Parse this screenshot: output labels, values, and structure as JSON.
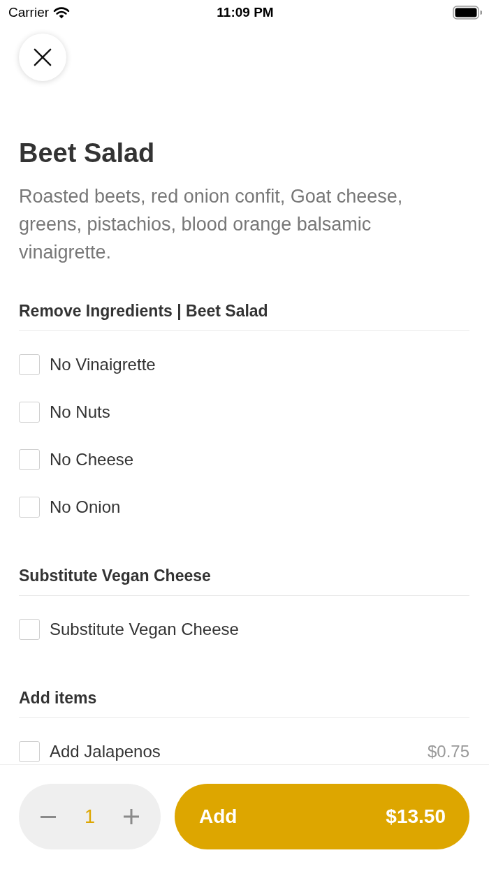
{
  "status_bar": {
    "carrier": "Carrier",
    "time": "11:09 PM"
  },
  "item": {
    "title": "Beet Salad",
    "description": "Roasted beets, red onion confit, Goat cheese, greens, pistachios, blood orange balsamic vinaigrette."
  },
  "sections": [
    {
      "title": "Remove Ingredients | Beet Salad",
      "options": [
        {
          "label": "No Vinaigrette",
          "checked": false
        },
        {
          "label": "No Nuts",
          "checked": false
        },
        {
          "label": "No Cheese",
          "checked": false
        },
        {
          "label": "No Onion",
          "checked": false
        }
      ]
    },
    {
      "title": "Substitute Vegan Cheese",
      "options": [
        {
          "label": "Substitute Vegan Cheese",
          "checked": false
        }
      ]
    },
    {
      "title": "Add items",
      "options": [
        {
          "label": "Add Jalapenos",
          "price": "$0.75",
          "checked": false
        }
      ]
    }
  ],
  "footer": {
    "quantity": "1",
    "add_button": {
      "label": "Add",
      "price": "$13.50"
    }
  }
}
